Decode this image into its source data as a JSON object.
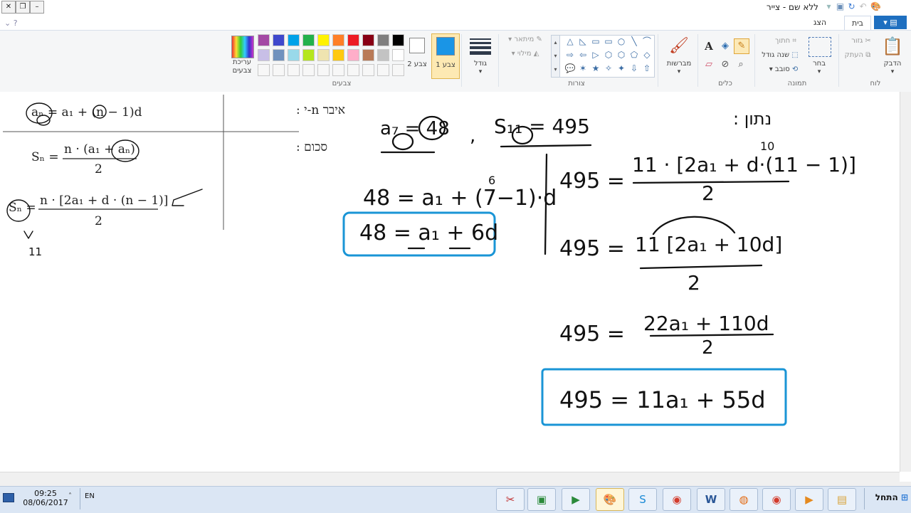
{
  "window": {
    "title": "ללא שם - צייר"
  },
  "tabs": [
    {
      "label": "בית"
    },
    {
      "label": "הצג"
    }
  ],
  "ribbon": {
    "clipboard": {
      "label": "לוח",
      "paste": "הדבק",
      "cut": "גזור",
      "copy": "העתק"
    },
    "image": {
      "label": "תמונה",
      "select": "בחר",
      "crop": "חתוך",
      "resize": "שנה גודל",
      "rotate": "סובב"
    },
    "tools": {
      "label": "כלים"
    },
    "brushes": {
      "label": "מברשות"
    },
    "shapes": {
      "label": "צורות",
      "outline": "מיתאר",
      "fill": "מילוי"
    },
    "size": {
      "label": "גודל"
    },
    "colors": {
      "label": "צבעים",
      "color1": "צבע 1",
      "color2": "צבע 2",
      "edit": "עריכת צבעים",
      "palette_row1": [
        "#000000",
        "#7f7f7f",
        "#880015",
        "#ed1c24",
        "#ff7f27",
        "#fff200",
        "#22b14c",
        "#00a2e8",
        "#3f48cc",
        "#a349a4"
      ],
      "palette_row2": [
        "#ffffff",
        "#c3c3c3",
        "#b97a57",
        "#ffaec9",
        "#ffc90e",
        "#efe4b0",
        "#b5e61d",
        "#99d9ea",
        "#7092be",
        "#c8bfe7"
      ],
      "color1_value": "#1a95e6",
      "color2_value": "#ffffff"
    }
  },
  "canvas": {
    "table": {
      "row1_label": "איבר n-י :",
      "row2_label": "סכום :",
      "formula1": "aₙ = a₁ + (n − 1)d",
      "formula2_lhs": "Sₙ =",
      "formula2_num": "n · (a₁ + aₙ)",
      "formula2_den": "2",
      "formula3_lhs": "Sₙ =",
      "formula3_num": "n · [2a₁ + d · (n − 1)]",
      "formula3_den": "2",
      "note_n": "11"
    },
    "handwriting": {
      "given": "נתון :",
      "a7": "a₇ = 48",
      "comma": ",",
      "s11": "S₁₁ = 495",
      "line1": "48 = a₁ + (7−1)·d",
      "line1_sup": "6",
      "boxed1": "48 = a₁ + 6d",
      "eq1": "495 =",
      "eq1_num": "11 · [2a₁ + d·(11 − 1)]",
      "eq1_sup": "10",
      "eq1_den": "2",
      "eq2": "495 =",
      "eq2_num": "11 [2a₁ + 10d]",
      "eq2_den": "2",
      "eq3": "495 =",
      "eq3_num": "22a₁ + 110d",
      "eq3_den": "2",
      "boxed2": "495 = 11a₁ + 55d"
    }
  },
  "taskbar": {
    "time": "09:25",
    "date": "08/06/2017",
    "language": "EN",
    "start_label": "התחל"
  }
}
